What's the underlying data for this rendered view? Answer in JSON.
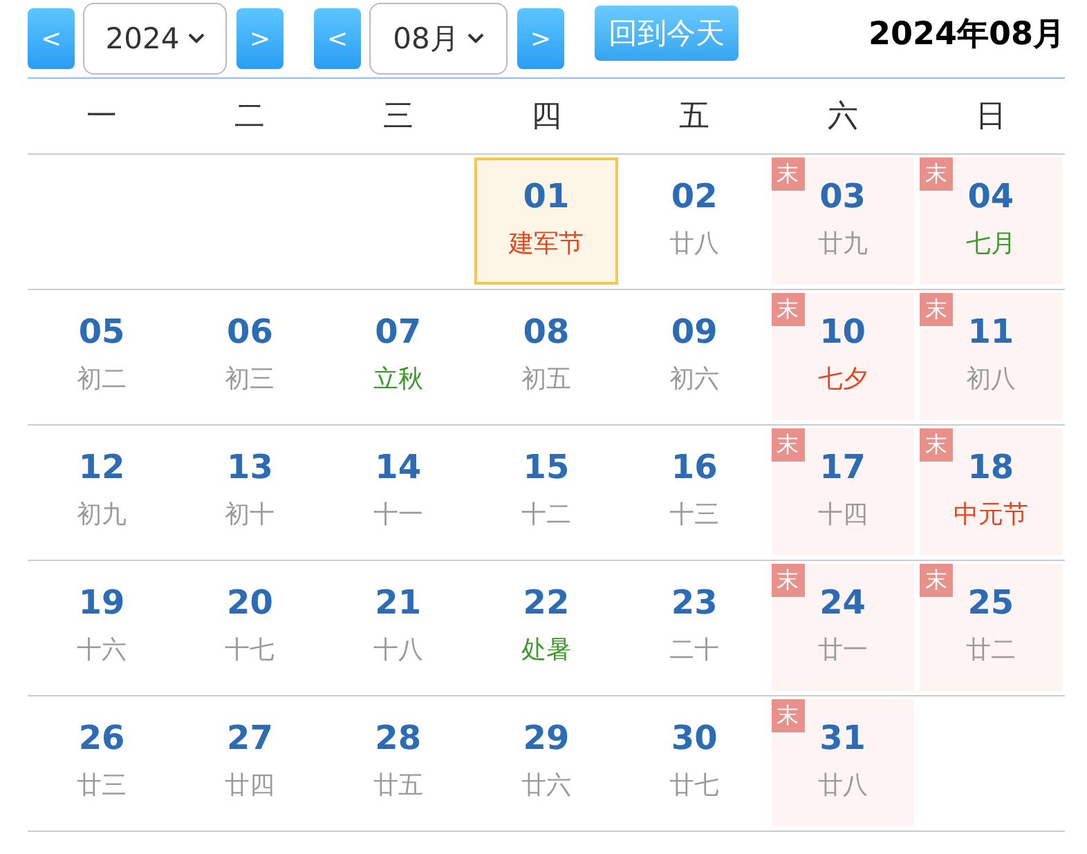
{
  "toolbar": {
    "prev_year": "<",
    "year": "2024",
    "next_year": ">",
    "prev_month": "<",
    "month": "08月",
    "next_month": ">",
    "today_button": "回到今天",
    "title": "2024年08月"
  },
  "weekdays": [
    "一",
    "二",
    "三",
    "四",
    "五",
    "六",
    "日"
  ],
  "weeks": [
    {
      "days": [
        {
          "kind": "blank"
        },
        {
          "kind": "blank"
        },
        {
          "kind": "blank"
        },
        {
          "kind": "day",
          "day": "01",
          "lunar": {
            "text": "建军节",
            "color": "#e8441c"
          },
          "selected": true
        },
        {
          "kind": "day",
          "day": "02",
          "lunar": {
            "text": "廿八",
            "color": "#9a9a9a"
          },
          "selected": false
        },
        {
          "kind": "day",
          "day": "03",
          "lunar": {
            "text": "廿九",
            "color": "#9a9a9a"
          },
          "badge": "末",
          "selected": false
        },
        {
          "kind": "day",
          "day": "04",
          "lunar": {
            "text": "七月",
            "color": "#3d9a2b"
          },
          "badge": "末",
          "selected": false
        }
      ]
    },
    {
      "days": [
        {
          "kind": "day",
          "day": "05",
          "lunar": {
            "text": "初二",
            "color": "#9a9a9a"
          },
          "selected": false
        },
        {
          "kind": "day",
          "day": "06",
          "lunar": {
            "text": "初三",
            "color": "#9a9a9a"
          },
          "selected": false
        },
        {
          "kind": "day",
          "day": "07",
          "lunar": {
            "text": "立秋",
            "color": "#3d9a2b"
          },
          "selected": false
        },
        {
          "kind": "day",
          "day": "08",
          "lunar": {
            "text": "初五",
            "color": "#9a9a9a"
          },
          "selected": false
        },
        {
          "kind": "day",
          "day": "09",
          "lunar": {
            "text": "初六",
            "color": "#9a9a9a"
          },
          "selected": false
        },
        {
          "kind": "day",
          "day": "10",
          "lunar": {
            "text": "七夕",
            "color": "#e8441c"
          },
          "badge": "末",
          "selected": false
        },
        {
          "kind": "day",
          "day": "11",
          "lunar": {
            "text": "初八",
            "color": "#9a9a9a"
          },
          "badge": "末",
          "selected": false
        }
      ]
    },
    {
      "days": [
        {
          "kind": "day",
          "day": "12",
          "lunar": {
            "text": "初九",
            "color": "#9a9a9a"
          },
          "selected": false
        },
        {
          "kind": "day",
          "day": "13",
          "lunar": {
            "text": "初十",
            "color": "#9a9a9a"
          },
          "selected": false
        },
        {
          "kind": "day",
          "day": "14",
          "lunar": {
            "text": "十一",
            "color": "#9a9a9a"
          },
          "selected": false
        },
        {
          "kind": "day",
          "day": "15",
          "lunar": {
            "text": "十二",
            "color": "#9a9a9a"
          },
          "selected": false
        },
        {
          "kind": "day",
          "day": "16",
          "lunar": {
            "text": "十三",
            "color": "#9a9a9a"
          },
          "selected": false
        },
        {
          "kind": "day",
          "day": "17",
          "lunar": {
            "text": "十四",
            "color": "#9a9a9a"
          },
          "badge": "末",
          "selected": false
        },
        {
          "kind": "day",
          "day": "18",
          "lunar": {
            "text": "中元节",
            "color": "#e8441c"
          },
          "badge": "末",
          "selected": false
        }
      ]
    },
    {
      "days": [
        {
          "kind": "day",
          "day": "19",
          "lunar": {
            "text": "十六",
            "color": "#9a9a9a"
          },
          "selected": false
        },
        {
          "kind": "day",
          "day": "20",
          "lunar": {
            "text": "十七",
            "color": "#9a9a9a"
          },
          "selected": false
        },
        {
          "kind": "day",
          "day": "21",
          "lunar": {
            "text": "十八",
            "color": "#9a9a9a"
          },
          "selected": false
        },
        {
          "kind": "day",
          "day": "22",
          "lunar": {
            "text": "处暑",
            "color": "#3d9a2b"
          },
          "selected": false
        },
        {
          "kind": "day",
          "day": "23",
          "lunar": {
            "text": "二十",
            "color": "#9a9a9a"
          },
          "selected": false
        },
        {
          "kind": "day",
          "day": "24",
          "lunar": {
            "text": "廿一",
            "color": "#9a9a9a"
          },
          "badge": "末",
          "selected": false
        },
        {
          "kind": "day",
          "day": "25",
          "lunar": {
            "text": "廿二",
            "color": "#9a9a9a"
          },
          "badge": "末",
          "selected": false
        }
      ]
    },
    {
      "days": [
        {
          "kind": "day",
          "day": "26",
          "lunar": {
            "text": "廿三",
            "color": "#9a9a9a"
          },
          "selected": false
        },
        {
          "kind": "day",
          "day": "27",
          "lunar": {
            "text": "廿四",
            "color": "#9a9a9a"
          },
          "selected": false
        },
        {
          "kind": "day",
          "day": "28",
          "lunar": {
            "text": "廿五",
            "color": "#9a9a9a"
          },
          "selected": false
        },
        {
          "kind": "day",
          "day": "29",
          "lunar": {
            "text": "廿六",
            "color": "#9a9a9a"
          },
          "selected": false
        },
        {
          "kind": "day",
          "day": "30",
          "lunar": {
            "text": "廿七",
            "color": "#9a9a9a"
          },
          "selected": false
        },
        {
          "kind": "day",
          "day": "31",
          "lunar": {
            "text": "廿八",
            "color": "#9a9a9a"
          },
          "badge": "末",
          "selected": false
        },
        {
          "kind": "blank"
        }
      ]
    }
  ]
}
